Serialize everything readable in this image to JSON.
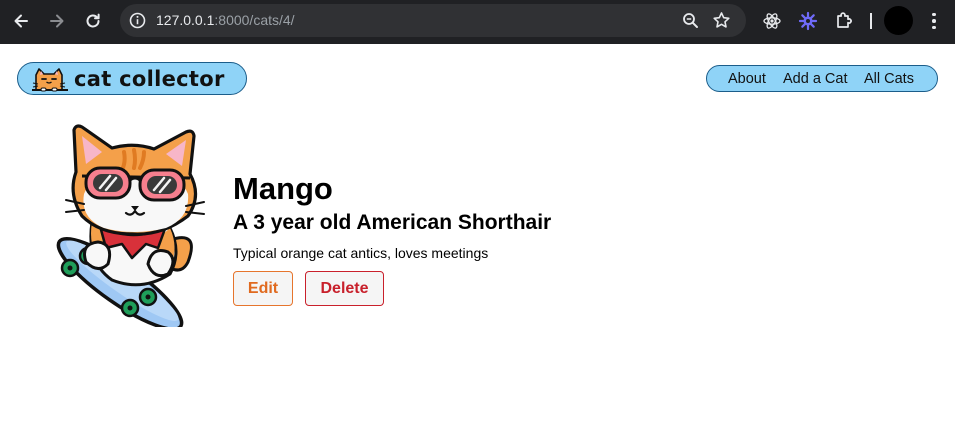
{
  "browser": {
    "url_host": "127.0.0.1",
    "url_path": ":8000/cats/4/",
    "icons": {
      "back": "arrow-left-icon",
      "forward": "arrow-right-icon",
      "reload": "reload-icon",
      "site_info": "info-icon",
      "zoom": "zoom-icon",
      "bookmark": "star-icon",
      "extension_react": "react-icon",
      "extension_other": "gear-burst-icon",
      "extensions": "puzzle-icon",
      "menu": "kebab-menu-icon"
    }
  },
  "header": {
    "logo_text": "cat collector",
    "nav": [
      "About",
      "Add a Cat",
      "All Cats"
    ]
  },
  "cat": {
    "name": "Mango",
    "summary": "A 3 year old American Shorthair",
    "description": "Typical orange cat antics, loves meetings"
  },
  "actions": {
    "edit": "Edit",
    "delete": "Delete"
  },
  "colors": {
    "chrome_bg": "#202124",
    "pill_bg": "#8fd3f7",
    "edit": "#e06a1f",
    "delete": "#c8202b"
  }
}
